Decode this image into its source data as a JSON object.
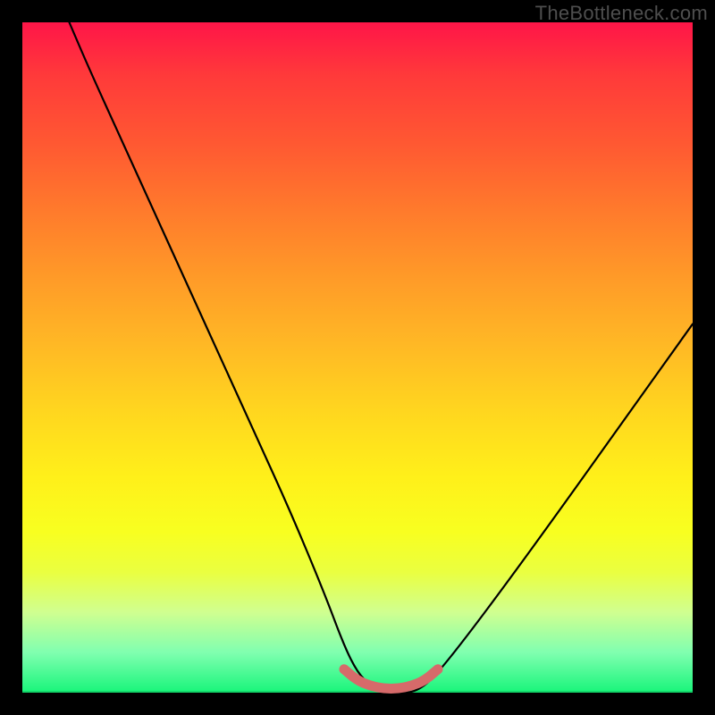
{
  "watermark": "TheBottleneck.com",
  "chart_data": {
    "type": "line",
    "title": "",
    "xlabel": "",
    "ylabel": "",
    "xlim": [
      0,
      100
    ],
    "ylim": [
      0,
      100
    ],
    "grid": false,
    "legend": false,
    "series": [
      {
        "name": "bottleneck-curve",
        "color": "#000000",
        "x": [
          7,
          10,
          15,
          20,
          25,
          30,
          35,
          40,
          45,
          48,
          50,
          52,
          54,
          56,
          58,
          60,
          62,
          66,
          72,
          80,
          90,
          100
        ],
        "y": [
          100,
          93,
          82,
          71,
          60,
          49,
          38,
          27,
          15,
          7,
          3,
          1,
          0,
          0,
          0,
          1,
          3,
          8,
          16,
          27,
          41,
          55
        ]
      },
      {
        "name": "flat-bottom-highlight",
        "color": "#d66a6a",
        "x": [
          48,
          50,
          52,
          54,
          56,
          58,
          60,
          62
        ],
        "y": [
          3.5,
          1.8,
          1.0,
          0.6,
          0.6,
          1.0,
          1.8,
          3.5
        ]
      }
    ]
  },
  "colors": {
    "background": "#000000",
    "gradient_top": "#ff1548",
    "gradient_bottom": "#18f57a",
    "curve": "#000000",
    "highlight": "#d66a6a",
    "watermark": "#4e4e4e"
  }
}
